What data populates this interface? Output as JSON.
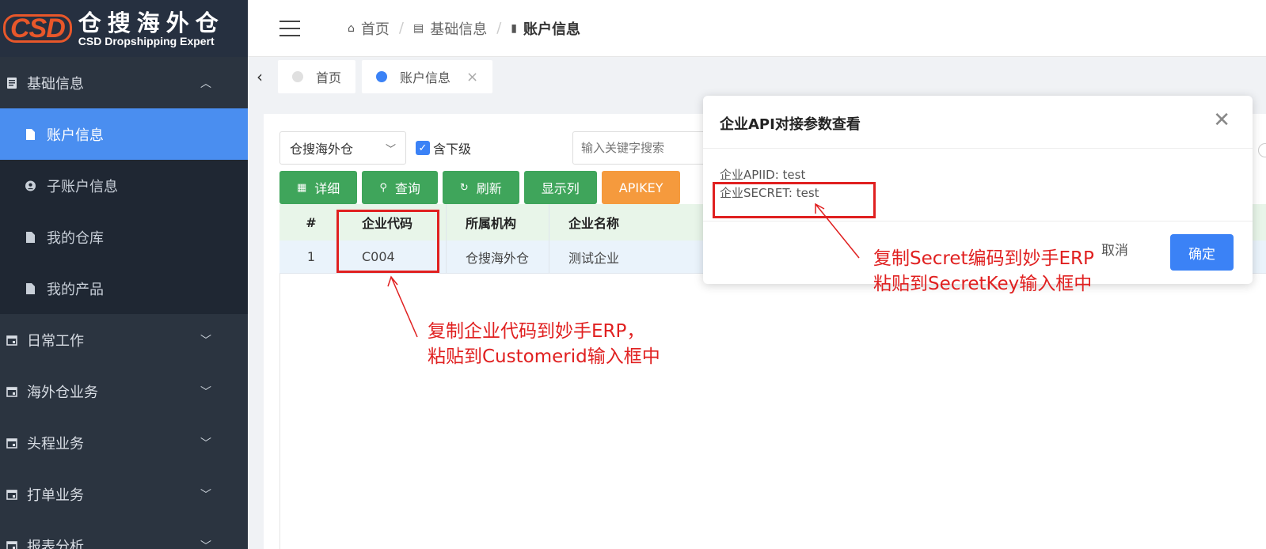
{
  "logo": {
    "brand": "CSD",
    "name_cn": "仓搜海外仓",
    "name_en": "CSD Dropshipping Expert"
  },
  "sidebar": {
    "groups": [
      {
        "label": "基础信息",
        "expanded": true,
        "icon": "document-icon",
        "items": [
          {
            "label": "账户信息",
            "active": true,
            "icon": "file-icon"
          },
          {
            "label": "子账户信息",
            "active": false,
            "icon": "user-circle-icon"
          },
          {
            "label": "我的仓库",
            "active": false,
            "icon": "file-icon"
          },
          {
            "label": "我的产品",
            "active": false,
            "icon": "file-icon"
          }
        ]
      },
      {
        "label": "日常工作",
        "expanded": false,
        "icon": "calendar-icon"
      },
      {
        "label": "海外仓业务",
        "expanded": false,
        "icon": "calendar-icon"
      },
      {
        "label": "头程业务",
        "expanded": false,
        "icon": "calendar-icon"
      },
      {
        "label": "打单业务",
        "expanded": false,
        "icon": "calendar-icon"
      },
      {
        "label": "报表分析",
        "expanded": false,
        "icon": "calendar-icon"
      }
    ]
  },
  "breadcrumb": {
    "items": [
      "首页",
      "基础信息",
      "账户信息"
    ]
  },
  "tabs": [
    {
      "label": "首页",
      "active": false
    },
    {
      "label": "账户信息",
      "active": true,
      "closable": true
    }
  ],
  "filters": {
    "org_select": "仓搜海外仓",
    "include_sub_label": "含下级",
    "include_sub_checked": true,
    "search_placeholder": "输入关键字搜索"
  },
  "toolbar": {
    "detail": "详细",
    "query": "查询",
    "refresh": "刷新",
    "columns": "显示列",
    "apikey": "APIKEY"
  },
  "table": {
    "headers": [
      "#",
      "企业代码",
      "所属机构",
      "企业名称"
    ],
    "rows": [
      [
        "1",
        "C004",
        "仓搜海外仓",
        "测试企业"
      ]
    ]
  },
  "modal": {
    "title": "企业API对接参数查看",
    "apiid_line": "企业APIID: test",
    "secret_line": "企业SECRET: test",
    "cancel": "取消",
    "ok": "确定"
  },
  "annotations": {
    "code_note_1": "复制企业代码到妙手ERP，",
    "code_note_2": "粘贴到Customerid输入框中",
    "secret_note_1": "复制Secret编码到妙手ERP",
    "secret_note_2": "粘贴到SecretKey输入框中",
    "color": "#e02020"
  },
  "colors": {
    "sidebar_bg": "#2b3440",
    "active_menu": "#4a8ef0",
    "primary": "#3b82f6",
    "success": "#3fa55b",
    "warning": "#f59a3d"
  }
}
